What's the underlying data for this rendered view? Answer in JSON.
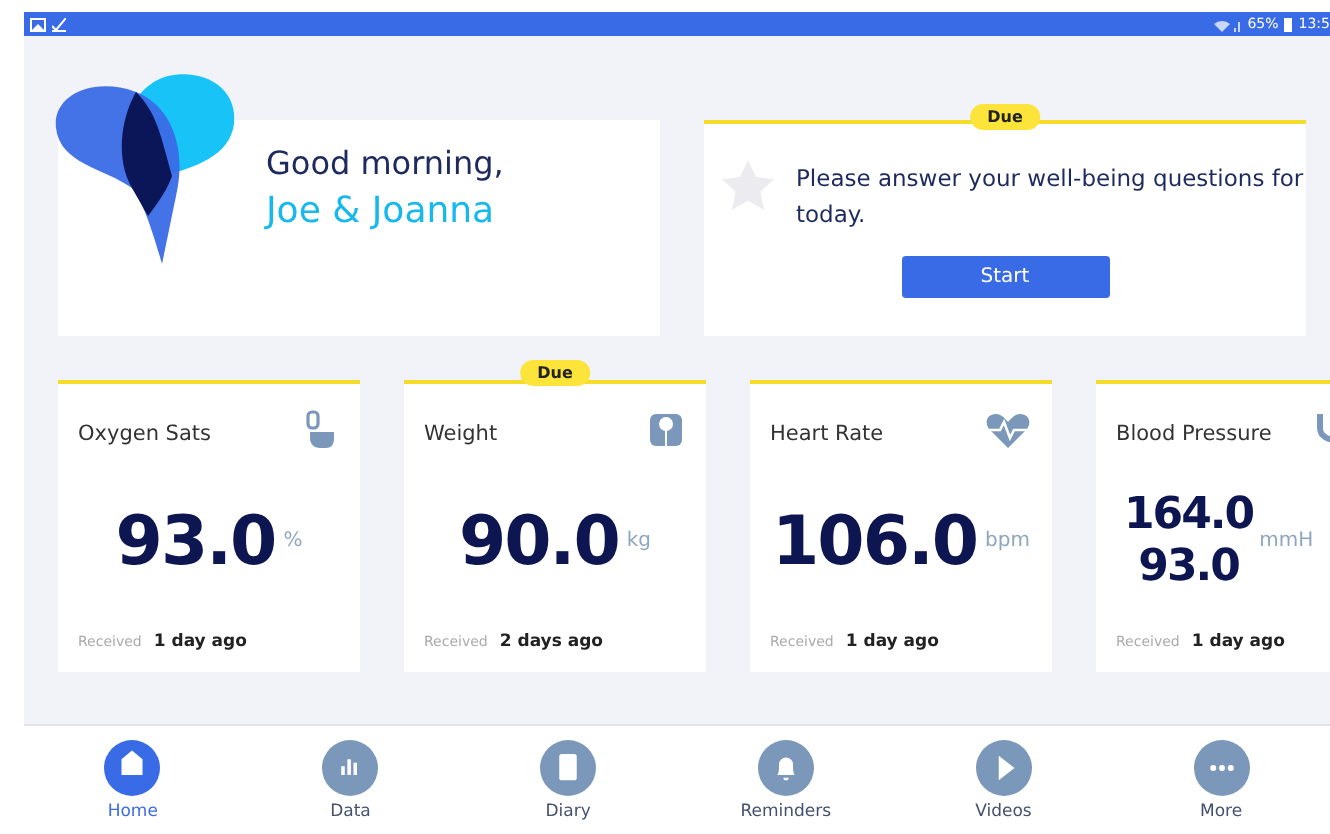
{
  "status_bar": {
    "battery": "65%",
    "time": "13:5"
  },
  "greeting": {
    "line1": "Good morning,",
    "name": "Joe & Joanna"
  },
  "task": {
    "badge": "Due",
    "text": "Please answer your well-being questions for today.",
    "button": "Start"
  },
  "metrics": [
    {
      "kind": "finger",
      "title": "Oxygen Sats",
      "values": [
        "93.0"
      ],
      "unit": "%",
      "received_label": "Received",
      "received": "1 day ago"
    },
    {
      "kind": "scale",
      "title": "Weight",
      "badge": "Due",
      "values": [
        "90.0"
      ],
      "unit": "kg",
      "received_label": "Received",
      "received": "2 days ago"
    },
    {
      "kind": "heart",
      "title": "Heart Rate",
      "values": [
        "106.0"
      ],
      "unit": "bpm",
      "received_label": "Received",
      "received": "1 day ago"
    },
    {
      "kind": "cuff",
      "title": "Blood Pressure",
      "values": [
        "164.0",
        "93.0"
      ],
      "unit": "mmH",
      "received_label": "Received",
      "received": "1 day ago"
    }
  ],
  "nav": [
    {
      "kind": "home",
      "label": "Home",
      "selected": true
    },
    {
      "kind": "data",
      "label": "Data",
      "selected": false
    },
    {
      "kind": "diary",
      "label": "Diary",
      "selected": false
    },
    {
      "kind": "bell",
      "label": "Reminders",
      "selected": false
    },
    {
      "kind": "play",
      "label": "Videos",
      "selected": false
    },
    {
      "kind": "more",
      "label": "More",
      "selected": false
    }
  ]
}
